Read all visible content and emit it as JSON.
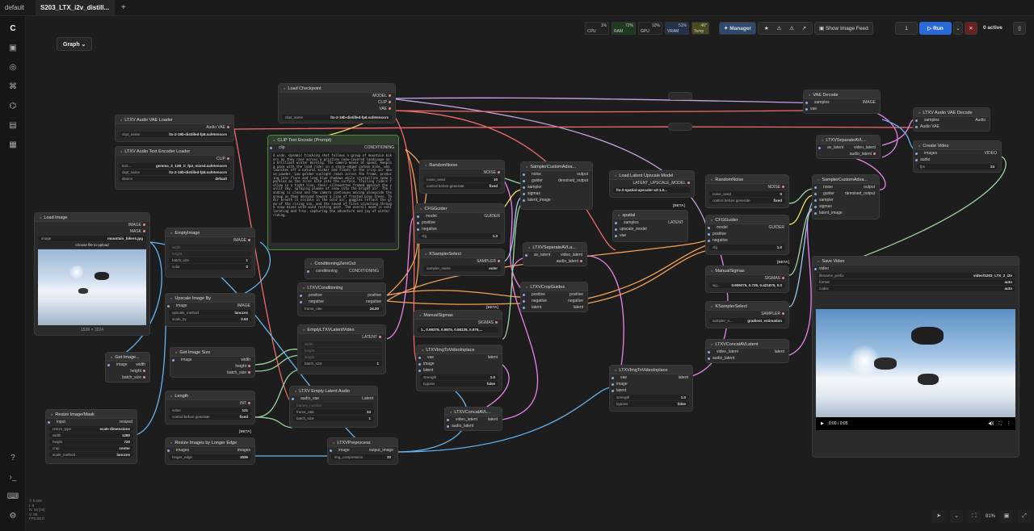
{
  "tabs": {
    "default": "default",
    "active": "S203_LTX_i2v_distill...",
    "dot": "●",
    "plus": "+"
  },
  "toolbar": {
    "graph": "Graph ⌄",
    "cpu_pct": "1%",
    "cpu": "CPU",
    "ram_pct": "72%",
    "ram": "RAM",
    "gpu_pct": "10%",
    "gpu": "GPU",
    "vram_pct": "51%",
    "vram": "VRAM",
    "temp": "46°",
    "temp_label": "Temp",
    "manager": "Manager",
    "show_feed": "Show Image Feed",
    "queue_count": "1",
    "run": "Run",
    "active": "0 active"
  },
  "stats": {
    "l1": "T: 0.00s",
    "l2": "I: 0",
    "l3": "N: 44 [44]",
    "l4": "V: 88",
    "l5": "FPS:60.0"
  },
  "bottom": {
    "zoom": "81%"
  },
  "nodes": {
    "load_checkpoint": {
      "title": "Load Checkpoint",
      "o1": "MODEL",
      "o2": "CLIP",
      "o3": "VAE",
      "w1k": "ckpt_name",
      "w1v": "ltx-2-19b-distilled-fp8.safetensors"
    },
    "audio_vae": {
      "title": "LTXV Audio VAE Loader",
      "o1": "Audio VAE",
      "w1k": "ckpt_name",
      "w1v": "ltx-2-19b-distilled-fp8.safetensors"
    },
    "audio_text_enc": {
      "title": "LTXV Audio Text Encoder Loader",
      "o1": "CLIP",
      "w1k": "text...",
      "w1v": "gemma_3_12B_it_fp4_mixed.safetensors",
      "w2k": "ckpt_name",
      "w2v": "ltx-2-19b-distilled-fp8.safetensors",
      "w3k": "device",
      "w3v": "default"
    },
    "clip_text": {
      "title": "CLIP Text Encode (Prompt)",
      "i1": "clip",
      "o1": "CONDITIONING",
      "text": "A wide, dynamic tracking shot follows a group of mountain bikers as they race across a pristine snow-covered landscape on a brilliant winter morning. The camera moves at speed, keeping pace with the lead rider on a sharp-edged carbon bike, who launches off a natural kicker and floats in the crisp air above powder. Low golden sunlight rakes across the frame, producing lens flare and long blue shadows while crystalline snow sparkles as the tires bite into the surface. Trailing riders follow in a tight line, their silhouettes framed against the sunlit sky, spraying plumes of snow into the bright air. The landing is clean and the camera continues moving alongside the group as they descend toward a line of frosted pine trees. Their breath is visible in the cold air, goggles reflect the glow of the rising sun, and the sound of tires crunching through snow mixes with wind rushing past. The overall mood is exhilarating and free, capturing the adventure and joy of winter riding."
    },
    "random_noise1": {
      "title": "RandomNoise",
      "o1": "NOISE",
      "w1k": "noise_seed",
      "w1v": "10",
      "w2k": "control before generate",
      "w2v": "fixed"
    },
    "sampler_custom1": {
      "title": "SamplerCustomAdva...",
      "i1": "noise",
      "i2": "guider",
      "i3": "sampler",
      "i4": "sigmas",
      "i5": "latent_image",
      "o1": "output",
      "o2": "denoised_output"
    },
    "cfg_guider1": {
      "title": "CFGGuider",
      "i1": "model",
      "i2": "positive",
      "i3": "negative",
      "o1": "GUIDER",
      "w1k": "cfg",
      "w1v": "1.0"
    },
    "ksampler_select1": {
      "title": "KSamplerSelect",
      "o1": "SAMPLER",
      "w1k": "sampler_name",
      "w1v": "euler"
    },
    "manual_sigmas1": {
      "title": "ManualSigmas",
      "o1": "SIGMAS",
      "w1v": "1., 0.99375, 0.9875, 0.98125, 0.975,..."
    },
    "cond_zero": {
      "title": "ConditioningZeroOut",
      "i1": "conditioning",
      "o1": "CONDITIONING"
    },
    "ltxv_cond": {
      "title": "LTXVConditioning",
      "i1": "positive",
      "i2": "negative",
      "o1": "positive",
      "o2": "negative",
      "w1k": "frame_rate",
      "w1v": "24.00"
    },
    "empty_latent": {
      "title": "EmptyLTXVLatentVideo",
      "o1": "LATENT",
      "w1k": "width",
      "w2k": "height",
      "w3k": "length",
      "w4k": "batch_size",
      "w4v": "1"
    },
    "empty_audio": {
      "title": "LTXV Empty Latent Audio",
      "i1": "audio_vae",
      "o1": "Latent",
      "w1k": "frames_number",
      "w2k": "frame_rate",
      "w2v": "24",
      "w3k": "batch_size",
      "w3v": "1"
    },
    "load_image": {
      "title": "Load Image",
      "o1": "IMAGE",
      "o2": "MASK",
      "w1k": "image",
      "w1v": "mountain_bikers.jpg",
      "btn": "choose file to upload",
      "caption": "1536 × 1024"
    },
    "empty_image": {
      "title": "EmptyImage",
      "o1": "IMAGE",
      "w1k": "width",
      "w2k": "height",
      "w3k": "batch_size",
      "w3v": "1",
      "w4k": "color",
      "w4v": "0"
    },
    "upscale_by": {
      "title": "Upscale Image By",
      "i1": "image",
      "o1": "IMAGE",
      "w1k": "upscale_method",
      "w1v": "lanczos",
      "w2k": "scale_by",
      "w2v": "0.50"
    },
    "get_image": {
      "title": "Get Image...",
      "i1": "image",
      "o1": "width",
      "o2": "height",
      "o3": "batch_size"
    },
    "get_image_size": {
      "title": "Get Image Size",
      "i1": "image",
      "o1": "width",
      "o2": "height",
      "o3": "batch_size"
    },
    "length": {
      "title": "Length",
      "o1": "INT",
      "w1k": "value",
      "w1v": "121",
      "w2k": "control before generate",
      "w2v": "fixed"
    },
    "resize_mask": {
      "title": "Resize Image/Mask",
      "i1": "input",
      "o1": "resized",
      "w1k": "resize_type",
      "w1v": "scale dimensions",
      "w2k": "width",
      "w2v": "1280",
      "w3k": "height",
      "w3v": "720",
      "w4k": "crop",
      "w4v": "center",
      "w5k": "scale_method",
      "w5v": "lanczos"
    },
    "resize_longer": {
      "title": "Resize Images by Longer Edge",
      "i1": "images",
      "o1": "images",
      "w1k": "longer_edge",
      "w1v": "1536"
    },
    "preprocess": {
      "title": "LTXVPreprocess",
      "i1": "image",
      "o1": "output_image",
      "w1k": "img_compression",
      "w1v": "33"
    },
    "img_to_video1": {
      "title": "LTXVImgToVideoInplace",
      "i1": "vae",
      "i2": "image",
      "i3": "latent",
      "o1": "latent",
      "w1k": "strength",
      "w1v": "1.0",
      "w2k": "bypass",
      "w2v": "false"
    },
    "concat1": {
      "title": "LTXVConcatAVL...",
      "i1": "video_latent",
      "i2": "audio_latent",
      "o1": "latent"
    },
    "separate1": {
      "title": "LTXVSeparateAVLa...",
      "i1": "av_latent",
      "o1": "video_latent",
      "o2": "audio_latent"
    },
    "crop_guides": {
      "title": "LTXVCropGuides",
      "i1": "positive",
      "i2": "negative",
      "i3": "latent",
      "o1": "positive",
      "o2": "negative",
      "o3": "latent"
    },
    "latent_upscale_model": {
      "title": "Load Latent Upscale Model",
      "o1": "LATENT_UPSCALE_MODEL",
      "w1v": "ltx-2-spatial-upscaler-x2-1.0..."
    },
    "spatial": {
      "title": "spatial",
      "i1": "samples",
      "i2": "upscale_model",
      "i3": "vae",
      "o1": "LATENT"
    },
    "random_noise2": {
      "title": "RandomNoise",
      "o1": "NOISE",
      "w1k": "noise_seed",
      "w1v": "0",
      "w2k": "control before generate",
      "w2v": "fixed"
    },
    "cfg_guider2": {
      "title": "CFGGuider",
      "i1": "model",
      "i2": "positive",
      "i3": "negative",
      "o1": "GUIDER",
      "w1k": "cfg",
      "w1v": "1.0"
    },
    "manual_sigmas2": {
      "title": "ManualSigmas",
      "o1": "SIGMAS",
      "w1k": "sig...",
      "w1v": "0.909375, 0.725, 0.421875, 0.0"
    },
    "ksampler_select2": {
      "title": "KSamplerSelect",
      "o1": "SAMPLER",
      "w1k": "sampler_n...",
      "w1v": "gradient_estimation"
    },
    "img_to_video2": {
      "title": "LTXVImgToVideoInplace",
      "i1": "vae",
      "i2": "image",
      "i3": "latent",
      "o1": "latent",
      "w1k": "strength",
      "w1v": "1.0",
      "w2k": "bypass",
      "w2v": "false"
    },
    "concat2": {
      "title": "LTXVConcatAVLatent",
      "i1": "video_latent",
      "i2": "audio_latent",
      "o1": "latent"
    },
    "sampler_custom2": {
      "title": "SamplerCustomAdva...",
      "i1": "noise",
      "i2": "guider",
      "i3": "sampler",
      "i4": "sigmas",
      "i5": "latent_image",
      "o1": "output",
      "o2": "denoised_output"
    },
    "separate2": {
      "title": "LTXVSeparateAVL...",
      "i1": "av_latent",
      "o1": "video_latent",
      "o2": "audio_latent"
    },
    "vae_decode": {
      "title": "VAE Decode",
      "i1": "samples",
      "i2": "vae",
      "o1": "IMAGE"
    },
    "audio_vae_decode": {
      "title": "LTXV Audio VAE Decode",
      "i1": "samples",
      "i2": "Audio VAE",
      "o1": "Audio"
    },
    "create_video": {
      "title": "Create Video",
      "i1": "images",
      "i2": "audio",
      "o1": "VIDEO",
      "w1k": "fps",
      "w1v": "24"
    },
    "save_video": {
      "title": "Save Video",
      "i1": "video",
      "w1k": "filename_prefix",
      "w1v": "video/S203_LTX_2_i2v",
      "w2k": "format",
      "w2v": "auto",
      "w3k": "codec",
      "w3v": "auto",
      "time": "0:00 / 0:05"
    }
  },
  "beta": "[BETA]"
}
